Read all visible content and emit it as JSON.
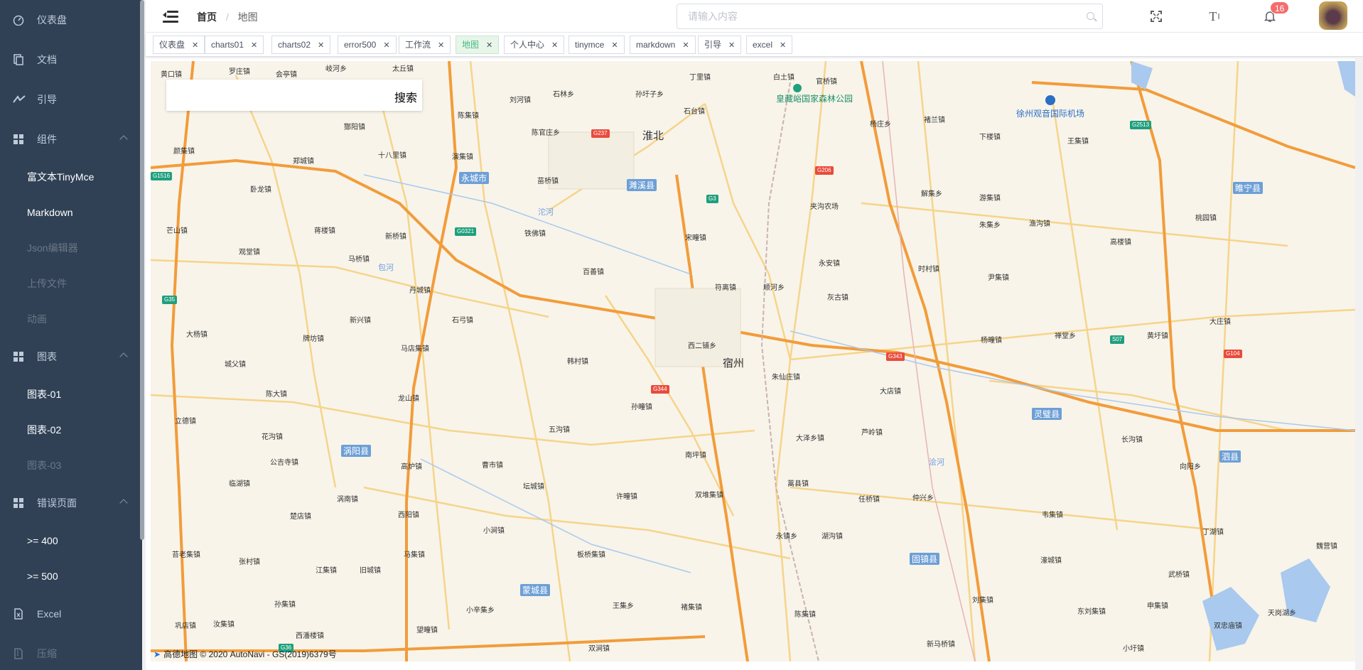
{
  "sidebar": {
    "items": [
      {
        "label": "仪表盘",
        "icon": "dashboard-icon"
      },
      {
        "label": "文档",
        "icon": "document-icon"
      },
      {
        "label": "引导",
        "icon": "guide-icon"
      },
      {
        "label": "组件",
        "icon": "component-icon",
        "expanded": true
      },
      {
        "label": "富文本TinyMce"
      },
      {
        "label": "Markdown"
      },
      {
        "label": "Json编辑器"
      },
      {
        "label": "上传文件"
      },
      {
        "label": "动画"
      },
      {
        "label": "图表",
        "icon": "chart-icon",
        "expanded": true
      },
      {
        "label": "图表-01"
      },
      {
        "label": "图表-02"
      },
      {
        "label": "图表-03"
      },
      {
        "label": "错误页面",
        "icon": "error-icon",
        "expanded": true
      },
      {
        "label": ">= 400"
      },
      {
        "label": ">= 500"
      },
      {
        "label": "Excel",
        "icon": "excel-icon"
      },
      {
        "label": "压缩",
        "icon": "zip-icon"
      }
    ]
  },
  "navbar": {
    "breadcrumb": {
      "home": "首页",
      "current": "地图"
    },
    "search_placeholder": "请输入内容",
    "size_icon_label": "T",
    "notification_count": "16"
  },
  "tags": [
    {
      "label": "仪表盘",
      "active": false
    },
    {
      "label": "charts01",
      "active": false
    },
    {
      "label": "charts02",
      "active": false
    },
    {
      "label": "error500",
      "active": false
    },
    {
      "label": "工作流",
      "active": false
    },
    {
      "label": "地图",
      "active": true
    },
    {
      "label": "个人中心",
      "active": false
    },
    {
      "label": "tinymce",
      "active": false
    },
    {
      "label": "markdown",
      "active": false
    },
    {
      "label": "引导",
      "active": false
    },
    {
      "label": "excel",
      "active": false
    }
  ],
  "map": {
    "search_button": "搜索",
    "attribution": "© 2020 AutoNavi - GS(2019)6379号",
    "logo_text": "高德地图",
    "cities": [
      "淮北",
      "宿州"
    ],
    "counties": [
      "永城市",
      "濉溪县",
      "睢宁县",
      "灵璧县",
      "泗县",
      "涡阳县",
      "蒙城县",
      "固镇县"
    ],
    "pois": [
      "皇藏峪国家森林公园",
      "徐州观音国际机场"
    ],
    "rivers": [
      "沱河",
      "浍河",
      "包河"
    ],
    "towns": [
      "黄口镇",
      "罗庄镇",
      "会亭镇",
      "岐河乡",
      "太丘镇",
      "刘河镇",
      "石林乡",
      "孙圩子乡",
      "丁里镇",
      "白土镇",
      "官桥镇",
      "陈集镇",
      "酂阳镇",
      "陈官庄乡",
      "石台镇",
      "杨庄乡",
      "褚兰镇",
      "下楼镇",
      "王集镇",
      "颜集镇",
      "十八里镇",
      "演集镇",
      "苗桥镇",
      "郑城镇",
      "卧龙镇",
      "夹沟农场",
      "解集乡",
      "游集镇",
      "朱集乡",
      "渔沟镇",
      "桃园镇",
      "高楼镇",
      "蒋楼镇",
      "芒山镇",
      "新桥镇",
      "铁佛镇",
      "宋疃镇",
      "永安镇",
      "时村镇",
      "尹集镇",
      "马桥镇",
      "百善镇",
      "符离镇",
      "顺河乡",
      "灰古镇",
      "丹城镇",
      "观堂镇",
      "新兴镇",
      "石弓镇",
      "西二铺乡",
      "朱仙庄镇",
      "大杨镇",
      "牌坊镇",
      "马店集镇",
      "城父镇",
      "韩村镇",
      "大店镇",
      "杨疃镇",
      "禅堂乡",
      "黄圩镇",
      "大庄镇",
      "陈大镇",
      "龙山镇",
      "孙疃镇",
      "立德镇",
      "花沟镇",
      "五沟镇",
      "大泽乡镇",
      "芦岭镇",
      "长沟镇",
      "公吉寺镇",
      "高炉镇",
      "曹市镇",
      "南坪镇",
      "向阳乡",
      "临湖镇",
      "涡南镇",
      "坛城镇",
      "许疃镇",
      "双堆集镇",
      "蒿县镇",
      "任桥镇",
      "仲兴乡",
      "韦集镇",
      "丁湖镇",
      "楚店镇",
      "西阳镇",
      "小涧镇",
      "永镇乡",
      "湖沟镇",
      "濠城镇",
      "申集镇",
      "武桥镇",
      "江集镇",
      "旧城镇",
      "马集镇",
      "板桥集镇",
      "刘集镇",
      "东刘集镇",
      "双忠庙镇",
      "孙集镇",
      "小辛集乡",
      "王集乡",
      "褚集镇",
      "陈集镇",
      "新马桥镇",
      "巩店镇",
      "汝集镇",
      "西潘楼镇",
      "望疃镇",
      "双涧镇",
      "小圩镇",
      "魏营镇",
      "天岗湖乡",
      "张村镇",
      "苔老集镇"
    ],
    "road_shields_red": [
      "G237",
      "G206",
      "G344",
      "G343",
      "G104"
    ],
    "road_shields_green": [
      "G1516",
      "G0321",
      "G3",
      "G35",
      "G2513",
      "S07",
      "G36"
    ]
  }
}
